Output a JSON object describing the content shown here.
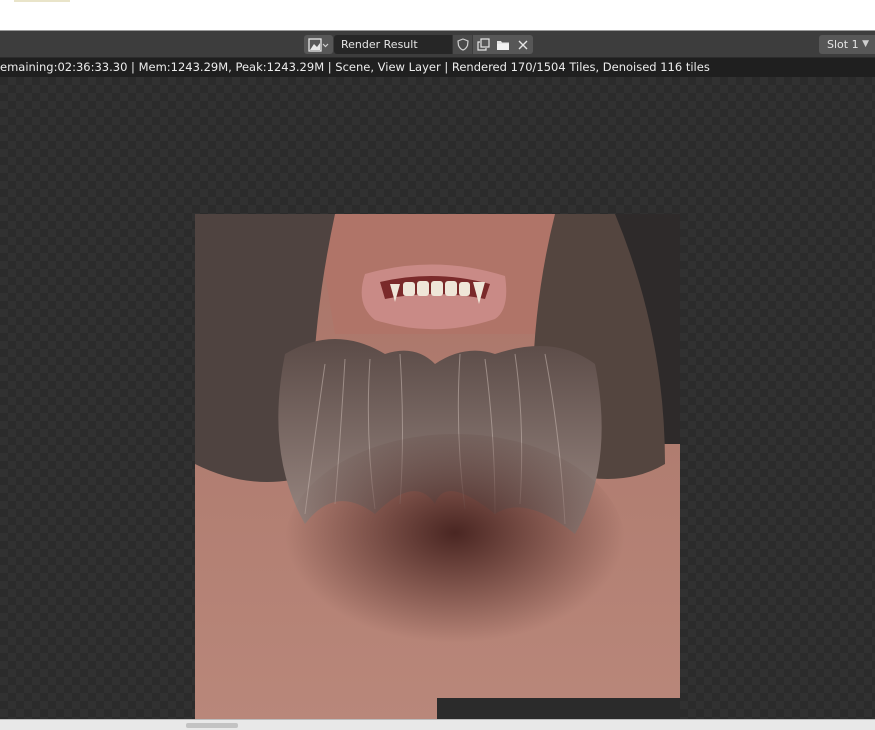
{
  "header": {
    "image_type_icon": "image-icon",
    "image_name": "Render Result",
    "icons": [
      "shield-icon",
      "duplicate-icon",
      "folder-icon",
      "close-icon"
    ],
    "slot": "Slot 1"
  },
  "status": {
    "text": "emaining:02:36:33.30 | Mem:1243.29M, Peak:1243.29M | Scene, View Layer | Rendered 170/1504 Tiles, Denoised 116 tiles"
  },
  "render": {
    "content": "partial render of a werewolf face: lower mouth with fangs, long grey beard, bare chest",
    "tiles_rendered": 170,
    "tiles_total": 1504,
    "tiles_denoised": 116
  },
  "colors": {
    "header_bg": "#3d3d3d",
    "status_bg": "#1f1f1f",
    "checker_dark": "#2b2b2b",
    "checker_light": "#313131",
    "skin": "#b27a6c",
    "beard": "#8a7a74"
  }
}
